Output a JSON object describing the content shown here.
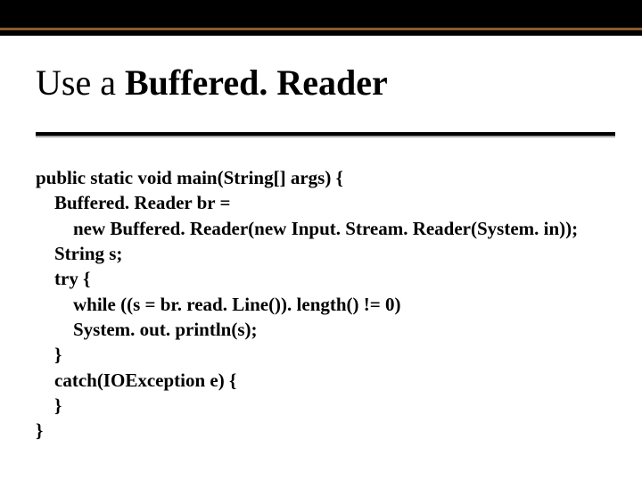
{
  "title": {
    "prefix": "Use a ",
    "bold": "Buffered. Reader"
  },
  "code": {
    "l01": "public static void main(String[] args) {",
    "l02": "    Buffered. Reader br =",
    "l03": "        new Buffered. Reader(new Input. Stream. Reader(System. in));",
    "l04": "    String s;",
    "l05": "    try {",
    "l06": "        while ((s = br. read. Line()). length() != 0)",
    "l07": "        System. out. println(s);",
    "l08": "    }",
    "l09": "    catch(IOException e) {",
    "l10": "    }",
    "l11": "}"
  }
}
